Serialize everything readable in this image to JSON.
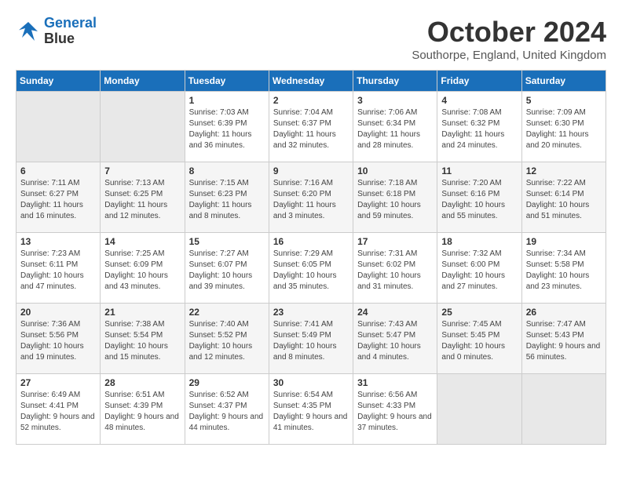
{
  "logo": {
    "line1": "General",
    "line2": "Blue"
  },
  "title": "October 2024",
  "location": "Southorpe, England, United Kingdom",
  "days_header": [
    "Sunday",
    "Monday",
    "Tuesday",
    "Wednesday",
    "Thursday",
    "Friday",
    "Saturday"
  ],
  "weeks": [
    [
      {
        "day": "",
        "info": ""
      },
      {
        "day": "",
        "info": ""
      },
      {
        "day": "1",
        "info": "Sunrise: 7:03 AM\nSunset: 6:39 PM\nDaylight: 11 hours\nand 36 minutes."
      },
      {
        "day": "2",
        "info": "Sunrise: 7:04 AM\nSunset: 6:37 PM\nDaylight: 11 hours\nand 32 minutes."
      },
      {
        "day": "3",
        "info": "Sunrise: 7:06 AM\nSunset: 6:34 PM\nDaylight: 11 hours\nand 28 minutes."
      },
      {
        "day": "4",
        "info": "Sunrise: 7:08 AM\nSunset: 6:32 PM\nDaylight: 11 hours\nand 24 minutes."
      },
      {
        "day": "5",
        "info": "Sunrise: 7:09 AM\nSunset: 6:30 PM\nDaylight: 11 hours\nand 20 minutes."
      }
    ],
    [
      {
        "day": "6",
        "info": "Sunrise: 7:11 AM\nSunset: 6:27 PM\nDaylight: 11 hours\nand 16 minutes."
      },
      {
        "day": "7",
        "info": "Sunrise: 7:13 AM\nSunset: 6:25 PM\nDaylight: 11 hours\nand 12 minutes."
      },
      {
        "day": "8",
        "info": "Sunrise: 7:15 AM\nSunset: 6:23 PM\nDaylight: 11 hours\nand 8 minutes."
      },
      {
        "day": "9",
        "info": "Sunrise: 7:16 AM\nSunset: 6:20 PM\nDaylight: 11 hours\nand 3 minutes."
      },
      {
        "day": "10",
        "info": "Sunrise: 7:18 AM\nSunset: 6:18 PM\nDaylight: 10 hours\nand 59 minutes."
      },
      {
        "day": "11",
        "info": "Sunrise: 7:20 AM\nSunset: 6:16 PM\nDaylight: 10 hours\nand 55 minutes."
      },
      {
        "day": "12",
        "info": "Sunrise: 7:22 AM\nSunset: 6:14 PM\nDaylight: 10 hours\nand 51 minutes."
      }
    ],
    [
      {
        "day": "13",
        "info": "Sunrise: 7:23 AM\nSunset: 6:11 PM\nDaylight: 10 hours\nand 47 minutes."
      },
      {
        "day": "14",
        "info": "Sunrise: 7:25 AM\nSunset: 6:09 PM\nDaylight: 10 hours\nand 43 minutes."
      },
      {
        "day": "15",
        "info": "Sunrise: 7:27 AM\nSunset: 6:07 PM\nDaylight: 10 hours\nand 39 minutes."
      },
      {
        "day": "16",
        "info": "Sunrise: 7:29 AM\nSunset: 6:05 PM\nDaylight: 10 hours\nand 35 minutes."
      },
      {
        "day": "17",
        "info": "Sunrise: 7:31 AM\nSunset: 6:02 PM\nDaylight: 10 hours\nand 31 minutes."
      },
      {
        "day": "18",
        "info": "Sunrise: 7:32 AM\nSunset: 6:00 PM\nDaylight: 10 hours\nand 27 minutes."
      },
      {
        "day": "19",
        "info": "Sunrise: 7:34 AM\nSunset: 5:58 PM\nDaylight: 10 hours\nand 23 minutes."
      }
    ],
    [
      {
        "day": "20",
        "info": "Sunrise: 7:36 AM\nSunset: 5:56 PM\nDaylight: 10 hours\nand 19 minutes."
      },
      {
        "day": "21",
        "info": "Sunrise: 7:38 AM\nSunset: 5:54 PM\nDaylight: 10 hours\nand 15 minutes."
      },
      {
        "day": "22",
        "info": "Sunrise: 7:40 AM\nSunset: 5:52 PM\nDaylight: 10 hours\nand 12 minutes."
      },
      {
        "day": "23",
        "info": "Sunrise: 7:41 AM\nSunset: 5:49 PM\nDaylight: 10 hours\nand 8 minutes."
      },
      {
        "day": "24",
        "info": "Sunrise: 7:43 AM\nSunset: 5:47 PM\nDaylight: 10 hours\nand 4 minutes."
      },
      {
        "day": "25",
        "info": "Sunrise: 7:45 AM\nSunset: 5:45 PM\nDaylight: 10 hours\nand 0 minutes."
      },
      {
        "day": "26",
        "info": "Sunrise: 7:47 AM\nSunset: 5:43 PM\nDaylight: 9 hours\nand 56 minutes."
      }
    ],
    [
      {
        "day": "27",
        "info": "Sunrise: 6:49 AM\nSunset: 4:41 PM\nDaylight: 9 hours\nand 52 minutes."
      },
      {
        "day": "28",
        "info": "Sunrise: 6:51 AM\nSunset: 4:39 PM\nDaylight: 9 hours\nand 48 minutes."
      },
      {
        "day": "29",
        "info": "Sunrise: 6:52 AM\nSunset: 4:37 PM\nDaylight: 9 hours\nand 44 minutes."
      },
      {
        "day": "30",
        "info": "Sunrise: 6:54 AM\nSunset: 4:35 PM\nDaylight: 9 hours\nand 41 minutes."
      },
      {
        "day": "31",
        "info": "Sunrise: 6:56 AM\nSunset: 4:33 PM\nDaylight: 9 hours\nand 37 minutes."
      },
      {
        "day": "",
        "info": ""
      },
      {
        "day": "",
        "info": ""
      }
    ]
  ]
}
